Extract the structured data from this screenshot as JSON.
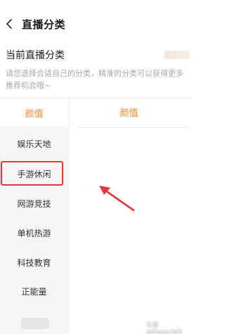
{
  "header": {
    "title": "直播分类"
  },
  "current": {
    "label": "当前直播分类"
  },
  "hint": "请您选择合适自己的分类，精准的分类可以获得更多推荐机会哦~",
  "sidebar": {
    "items": [
      {
        "label": "颜值"
      },
      {
        "label": "娱乐天地"
      },
      {
        "label": "手游休闲"
      },
      {
        "label": "网游竞技"
      },
      {
        "label": "单机热游"
      },
      {
        "label": "科技教育"
      },
      {
        "label": "正能量"
      }
    ]
  },
  "content": {
    "tab": "颜值"
  },
  "watermark": "头条 @Daisy345",
  "colors": {
    "accent": "#f28a1e",
    "highlight": "#e8343a"
  }
}
